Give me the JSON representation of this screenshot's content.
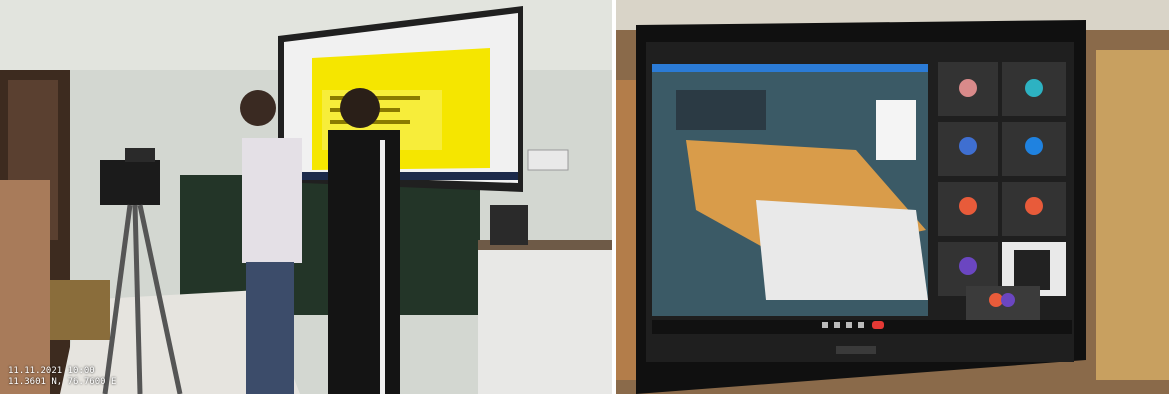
{
  "photos": {
    "left": {
      "timestamp_line1": "11.11.2021 10:00",
      "timestamp_line2": "11.3601 N, 76.7600 E"
    },
    "right": {
      "laptop_brand": "acer"
    }
  },
  "colors": {
    "wall": "#cfd4cf",
    "slide_yellow": "#f5e600",
    "table_wood": "#b98a5a",
    "meet_bg": "#1f1f1f",
    "end_call_red": "#e53935"
  }
}
